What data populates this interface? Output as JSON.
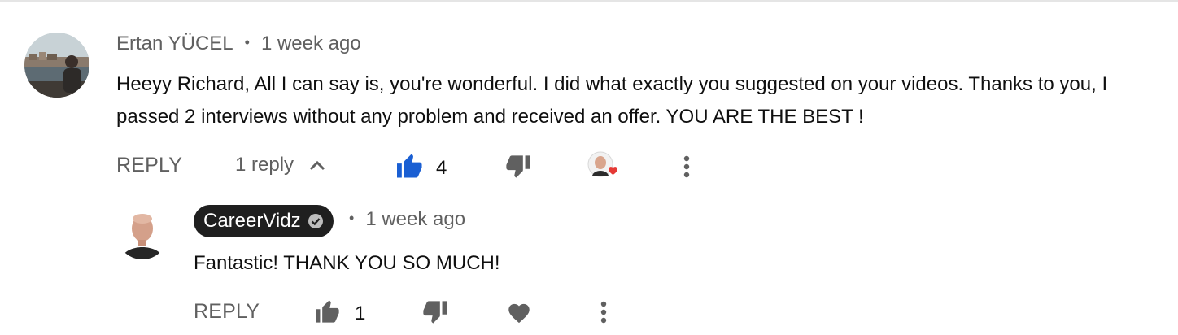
{
  "comment": {
    "author": "Ertan YÜCEL",
    "separator": "•",
    "time": "1 week ago",
    "text_line1": "Heeyy Richard, All I can say is, you're wonderful. I did what exactly you suggested on your videos. Thanks to you, I",
    "text_line2": "passed 2 interviews without any problem and received an offer. YOU ARE THE BEST !",
    "actions": {
      "reply_label": "REPLY",
      "replies_label": "1 reply",
      "like_count": "4"
    },
    "colors": {
      "like_active": "#1a73e8",
      "heart": "#e53935"
    }
  },
  "reply": {
    "author": "CareerVidz",
    "separator": "•",
    "time": "1 week ago",
    "text": "Fantastic! THANK YOU SO MUCH!",
    "actions": {
      "reply_label": "REPLY",
      "like_count": "1"
    }
  }
}
